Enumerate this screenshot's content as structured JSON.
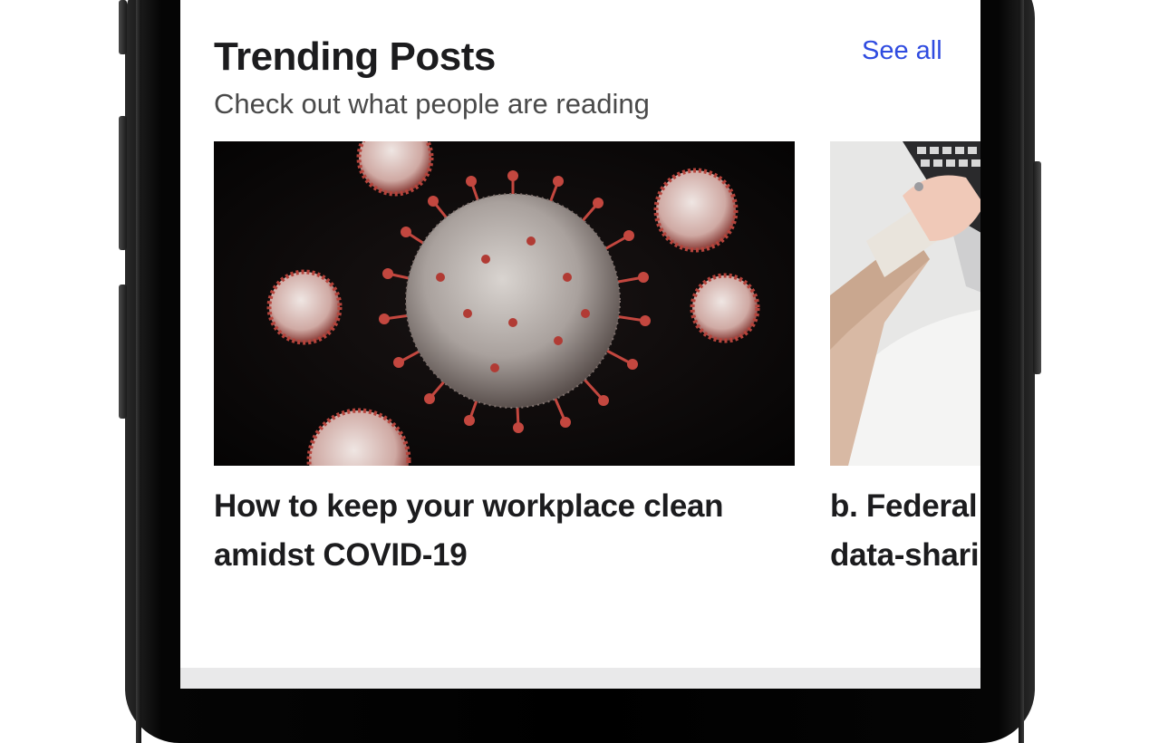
{
  "section": {
    "title": "Trending Posts",
    "subtitle": "Check out what people are reading",
    "see_all_label": "See all"
  },
  "posts": [
    {
      "title": " How to keep your workplace clean amidst COVID-19",
      "image_icon": "coronavirus-image"
    },
    {
      "title": "b. Federal data-shari",
      "title_line1": "b. Federal",
      "title_line2": "data-shari",
      "image_icon": "laptop-typing-image"
    }
  ],
  "colors": {
    "accent": "#2f4be0",
    "title": "#1c1c1e",
    "subtitle": "#4a4a4a",
    "frame": "#000000"
  }
}
